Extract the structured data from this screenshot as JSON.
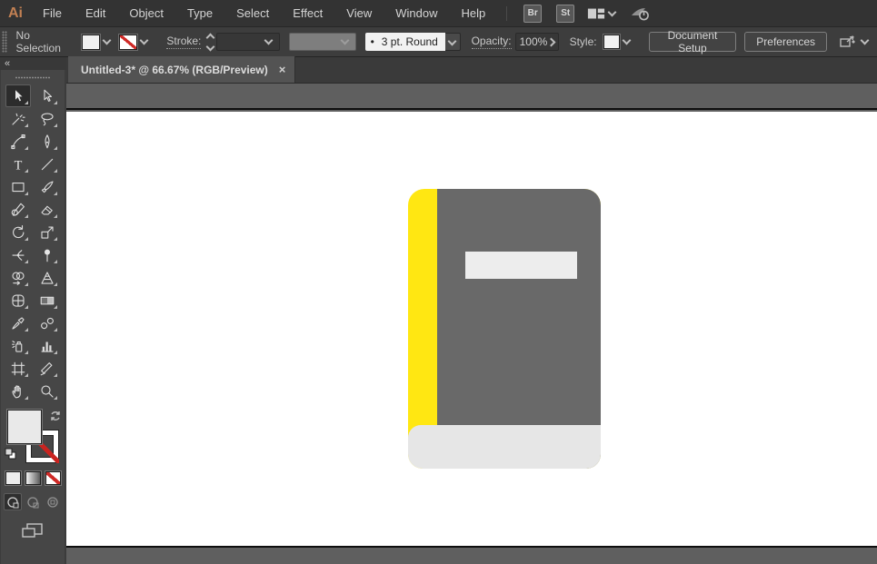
{
  "window": {
    "logo_text": "Ai"
  },
  "menubar": {
    "menus": [
      {
        "label": "File"
      },
      {
        "label": "Edit"
      },
      {
        "label": "Object"
      },
      {
        "label": "Type"
      },
      {
        "label": "Select"
      },
      {
        "label": "Effect"
      },
      {
        "label": "View"
      },
      {
        "label": "Window"
      },
      {
        "label": "Help"
      }
    ],
    "bridge_button": "Br",
    "stock_button": "St"
  },
  "controlbar": {
    "selection_status": "No Selection",
    "stroke_label": "Stroke:",
    "brush_bullet": "•",
    "brush_value": "3 pt. Round",
    "opacity_label": "Opacity:",
    "opacity_value": "100%",
    "style_label": "Style:",
    "document_setup_button": "Document Setup",
    "preferences_button": "Preferences"
  },
  "tabbar": {
    "active_tab": {
      "title": "Untitled-3* @ 66.67% (RGB/Preview)",
      "close_glyph": "×"
    }
  },
  "toolbar": {
    "collapse_glyph": "«",
    "tools": [
      {
        "name": "selection-tool",
        "selected": true
      },
      {
        "name": "direct-selection-tool",
        "selected": false
      },
      {
        "name": "magic-wand-tool",
        "selected": false
      },
      {
        "name": "lasso-tool",
        "selected": false
      },
      {
        "name": "pen-tool",
        "selected": false
      },
      {
        "name": "curvature-tool",
        "selected": false
      },
      {
        "name": "type-tool",
        "selected": false
      },
      {
        "name": "line-segment-tool",
        "selected": false
      },
      {
        "name": "rectangle-tool",
        "selected": false
      },
      {
        "name": "paintbrush-tool",
        "selected": false
      },
      {
        "name": "pencil-tool",
        "selected": false
      },
      {
        "name": "eraser-tool",
        "selected": false
      },
      {
        "name": "rotate-tool",
        "selected": false
      },
      {
        "name": "scale-tool",
        "selected": false
      },
      {
        "name": "width-tool",
        "selected": false
      },
      {
        "name": "puppet-warp-tool",
        "selected": false
      },
      {
        "name": "shape-builder-tool",
        "selected": false
      },
      {
        "name": "perspective-grid-tool",
        "selected": false
      },
      {
        "name": "mesh-tool",
        "selected": false
      },
      {
        "name": "gradient-tool",
        "selected": false
      },
      {
        "name": "eyedropper-tool",
        "selected": false
      },
      {
        "name": "blend-tool",
        "selected": false
      },
      {
        "name": "symbol-sprayer-tool",
        "selected": false
      },
      {
        "name": "column-graph-tool",
        "selected": false
      },
      {
        "name": "artboard-tool",
        "selected": false
      },
      {
        "name": "slice-tool",
        "selected": false
      },
      {
        "name": "hand-tool",
        "selected": false
      },
      {
        "name": "zoom-tool",
        "selected": false
      }
    ]
  },
  "artwork": {
    "book": {
      "spine_color": "#FFE712",
      "cover_color": "#696969",
      "pages_color": "#E6E6E6",
      "label_color": "#EDEDED"
    }
  },
  "colors": {
    "ui_dark": "#333333",
    "pasteboard_gray": "#5F5F5F",
    "artboard_white": "#FFFFFF",
    "none_slash_red": "#CF2A27"
  }
}
